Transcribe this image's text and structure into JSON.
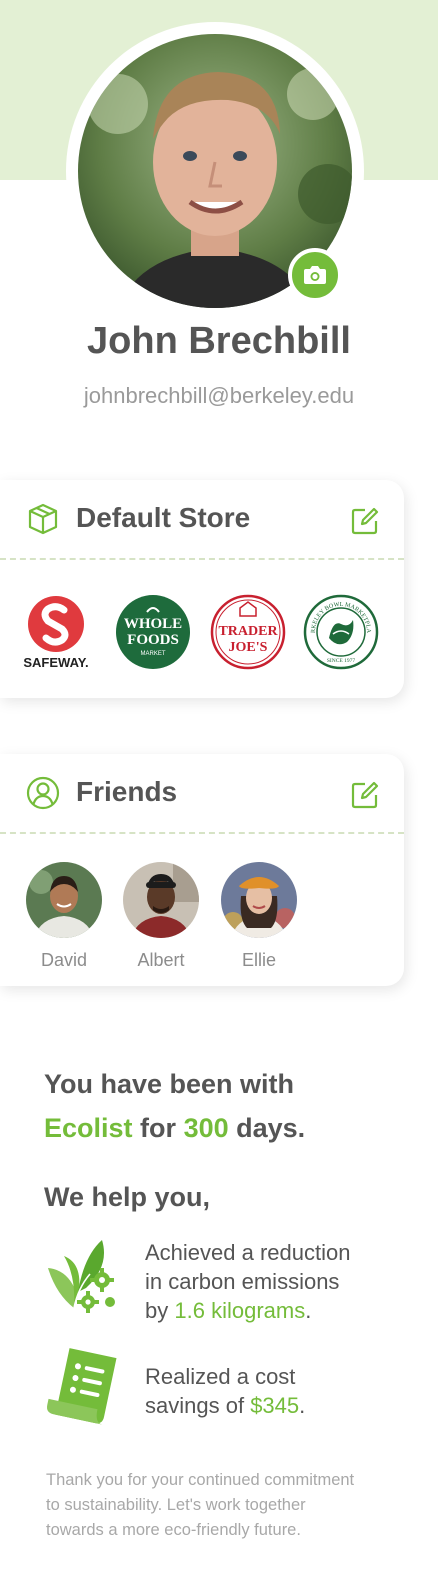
{
  "profile": {
    "name": "John Brechbill",
    "email": "johnbrechbill@berkeley.edu"
  },
  "default_store": {
    "title": "Default Store",
    "stores": [
      {
        "name": "Safeway",
        "logo_text": "SAFEWAY."
      },
      {
        "name": "Whole Foods Market",
        "logo_lines": [
          "WHOLE",
          "FOODS",
          "MARKET"
        ]
      },
      {
        "name": "Trader Joe's",
        "logo_lines": [
          "TRADER",
          "JOE'S"
        ]
      },
      {
        "name": "Berkeley Bowl Marketplace",
        "logo_text": "BERKELEY BOWL MARKETPLACE",
        "logo_sub": "SINCE 1977"
      }
    ]
  },
  "friends": {
    "title": "Friends",
    "list": [
      {
        "name": "David"
      },
      {
        "name": "Albert"
      },
      {
        "name": "Ellie"
      }
    ]
  },
  "stats": {
    "days_prefix": "You have been with",
    "brand": "Ecolist",
    "days_for": "for",
    "days_count": "300",
    "days_suffix": "days.",
    "help_heading": "We help you,",
    "carbon_line1": "Achieved a reduction",
    "carbon_line2": "in carbon emissions",
    "carbon_prefix": "by",
    "carbon_value": "1.6 kilograms",
    "carbon_suffix": ".",
    "savings_line1": "Realized a cost",
    "savings_prefix": "savings of",
    "savings_value": "$345",
    "savings_suffix": "."
  },
  "thanks": {
    "line1": "Thank you for your continued commitment",
    "line2": "to sustainability. Let's work together",
    "line3": "towards a more eco-friendly future."
  },
  "icons": {
    "camera": "camera-icon",
    "store": "box-icon",
    "friends": "user-circle-icon",
    "edit": "edit-icon",
    "carbon": "leaf-gears-icon",
    "receipt": "receipt-icon"
  },
  "colors": {
    "accent": "#74bc3a",
    "banner": "#e3f0d4",
    "text": "#555555",
    "muted": "#9a9a9a"
  }
}
